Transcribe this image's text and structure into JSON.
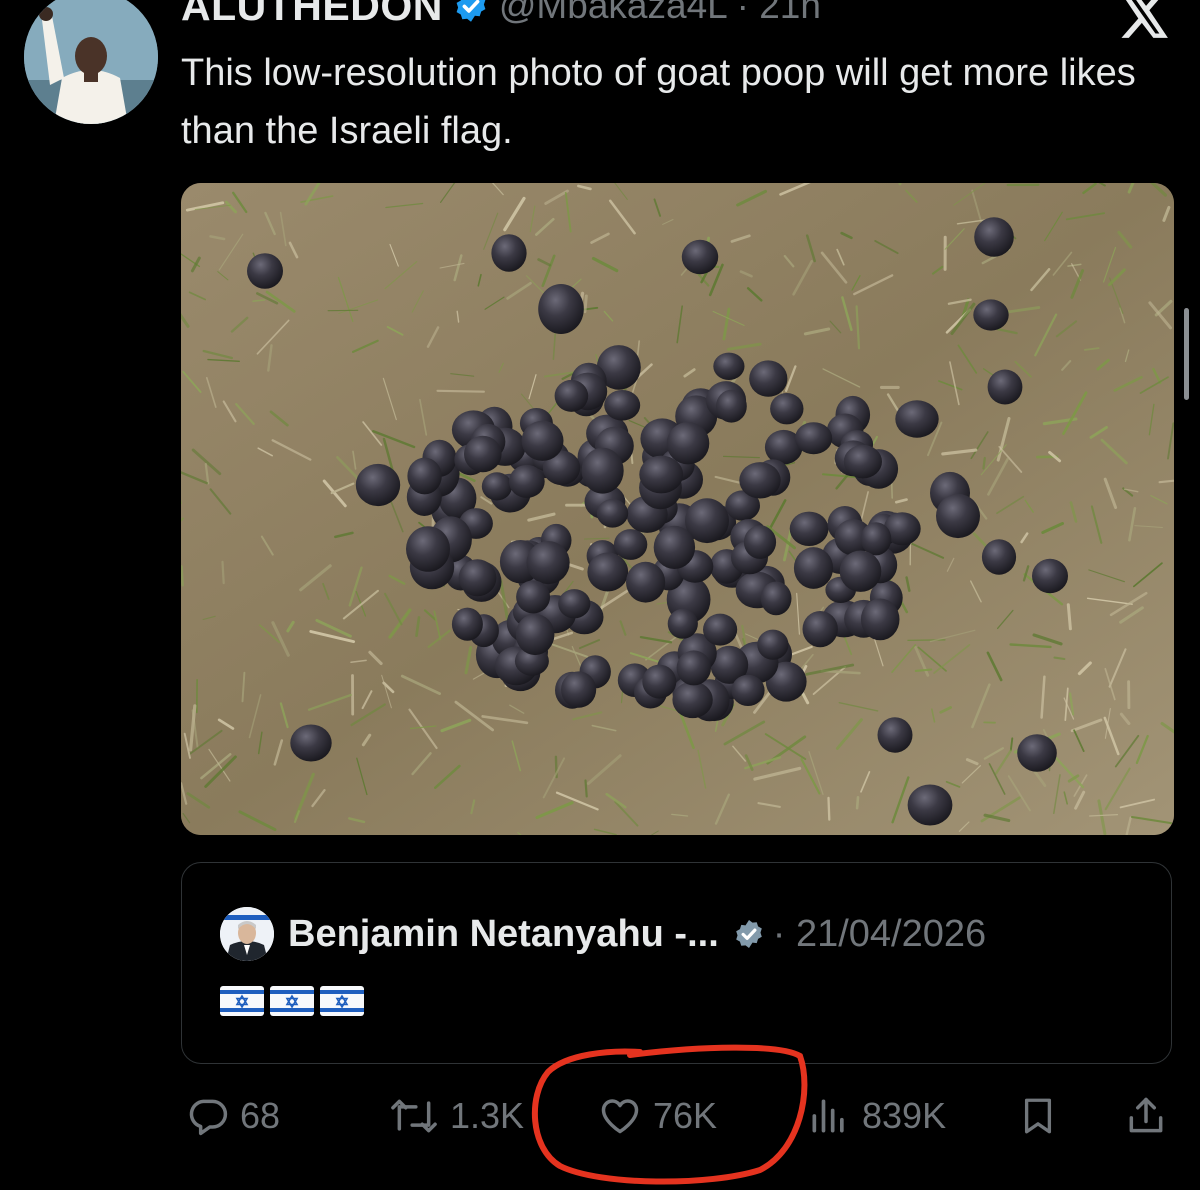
{
  "tweet": {
    "display_name": "ALUTHEDON",
    "handle_and_time": "@Mbakaza4L · 21h",
    "text": "This low-resolution photo of goat poop will get more likes than the Israeli flag.",
    "media_description": "goat-droppings-on-grass-photo"
  },
  "quote": {
    "name": "Benjamin Netanyahu -...",
    "date": "· 21/04/2026",
    "flags": [
      "israel-flag",
      "israel-flag",
      "israel-flag"
    ]
  },
  "actions": {
    "replies": "68",
    "reposts": "1.3K",
    "likes": "76K",
    "views": "839K"
  },
  "colors": {
    "background": "#000000",
    "text": "#e7e9ea",
    "muted": "#71767b",
    "verified": "#1d9bf0",
    "annotation": "#e5331f"
  }
}
